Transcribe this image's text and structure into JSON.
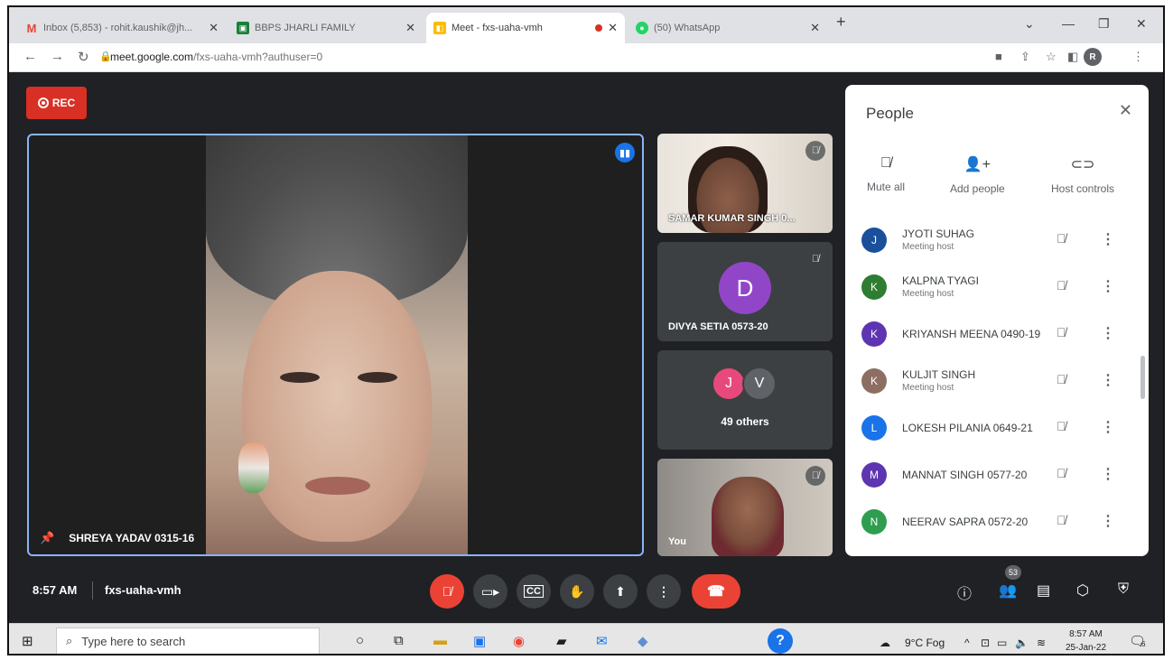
{
  "browser": {
    "tabs": [
      {
        "title": "Inbox (5,853) - rohit.kaushik@jh...",
        "favicon": "gmail-icon",
        "color": "#ea4335"
      },
      {
        "title": "BBPS JHARLI FAMILY",
        "favicon": "classroom-icon",
        "color": "#188038"
      },
      {
        "title": "Meet - fxs-uaha-vmh",
        "favicon": "meet-icon",
        "color": "#fbbc04"
      },
      {
        "title": "(50) WhatsApp",
        "favicon": "whatsapp-icon",
        "color": "#25d366"
      }
    ],
    "url_host": "meet.google.com",
    "url_path": "/fxs-uaha-vmh?authuser=0",
    "profile_initial": "R"
  },
  "meet": {
    "rec_label": "REC",
    "main_participant": "SHREYA YADAV 0315-16",
    "tiles": {
      "samar": "SAMAR KUMAR SINGH 0...",
      "divya_initial": "D",
      "divya": "DIVYA SETIA 0573-20",
      "others_initials": [
        "J",
        "V"
      ],
      "others_label": "49 others",
      "you": "You"
    },
    "time": "8:57 AM",
    "meeting_code": "fxs-uaha-vmh",
    "participant_count": "53"
  },
  "people": {
    "title": "People",
    "actions": {
      "mute_all": "Mute all",
      "add_people": "Add people",
      "host_controls": "Host controls"
    },
    "list": [
      {
        "initial": "J",
        "name": "JYOTI SUHAG",
        "role": "Meeting host",
        "color": "#1a4f9c"
      },
      {
        "initial": "K",
        "name": "KALPNA TYAGI",
        "role": "Meeting host",
        "color": "#2e7d32"
      },
      {
        "initial": "K",
        "name": "KRIYANSH MEENA 0490-19",
        "role": "",
        "color": "#5e35b1"
      },
      {
        "initial": "K",
        "name": "KULJIT SINGH",
        "role": "Meeting host",
        "color": "#8d6e63"
      },
      {
        "initial": "L",
        "name": "LOKESH PILANIA 0649-21",
        "role": "",
        "color": "#1a73e8"
      },
      {
        "initial": "M",
        "name": "MANNAT SINGH 0577-20",
        "role": "",
        "color": "#5e35b1"
      },
      {
        "initial": "N",
        "name": "NEERAV SAPRA 0572-20",
        "role": "",
        "color": "#2e9d4f"
      }
    ]
  },
  "taskbar": {
    "search_placeholder": "Type here to search",
    "weather": "9°C Fog",
    "time": "8:57 AM",
    "date": "25-Jan-22",
    "notification_count": "6"
  },
  "colors": {
    "accent": "#8ab4f8",
    "danger": "#ea4335",
    "bg": "#202124"
  }
}
